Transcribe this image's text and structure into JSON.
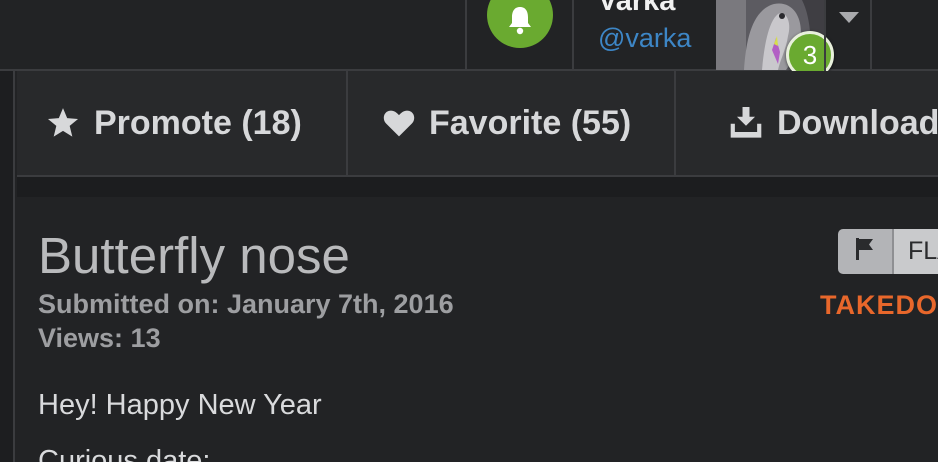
{
  "header": {
    "user_name": "Varka",
    "user_handle": "@varka",
    "notification_count": "3"
  },
  "actions": {
    "promote_label": "Promote (18)",
    "favorite_label": "Favorite (55)",
    "download_label": "Download"
  },
  "post": {
    "title": "Butterfly nose",
    "submitted": "Submitted on: January 7th, 2016",
    "views": "Views: 13",
    "body_line_1": "Hey! Happy New Year",
    "body_line_2": "Curious date:"
  },
  "flag": {
    "label": "FLAG",
    "takedown": "TAKEDOWN"
  },
  "colors": {
    "accent_green": "#6aaa30",
    "link_blue": "#3d86c6",
    "takedown_orange": "#e8672b"
  }
}
